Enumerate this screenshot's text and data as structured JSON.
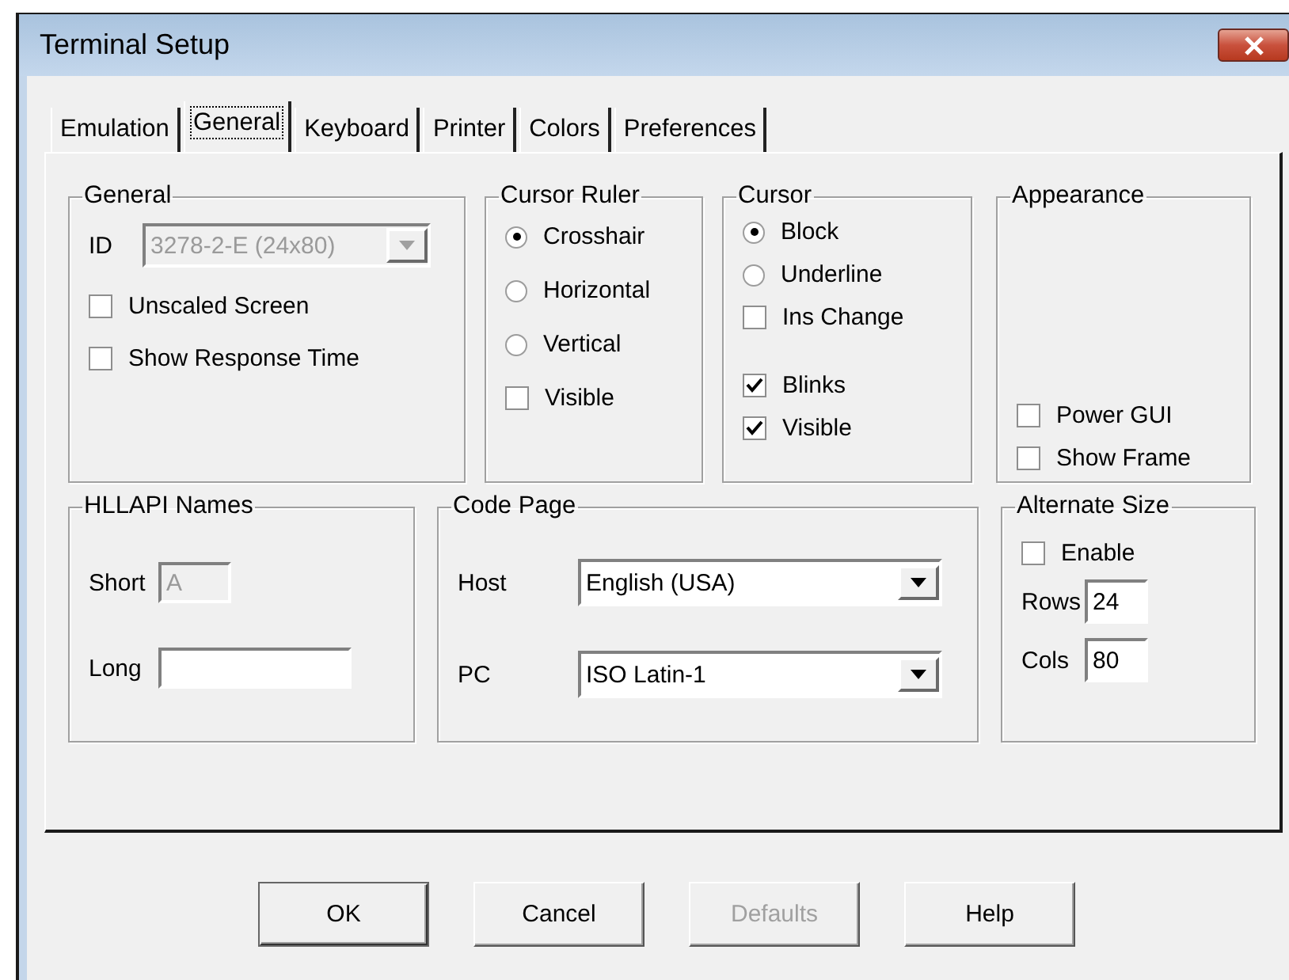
{
  "window": {
    "title": "Terminal Setup"
  },
  "tabs": [
    {
      "label": "Emulation",
      "selected": false
    },
    {
      "label": "General",
      "selected": true
    },
    {
      "label": "Keyboard",
      "selected": false
    },
    {
      "label": "Printer",
      "selected": false
    },
    {
      "label": "Colors",
      "selected": false
    },
    {
      "label": "Preferences",
      "selected": false
    }
  ],
  "rows": [
    [
      {
        "title": "General",
        "items": [
          {
            "kind": "dropdown",
            "label": "ID",
            "value": "3278-2-E (24x80)",
            "disabled": true
          },
          {
            "kind": "checkbox",
            "label": "Unscaled Screen",
            "checked": false
          },
          {
            "kind": "checkbox",
            "label": "Show Response Time",
            "checked": false
          }
        ]
      },
      {
        "title": "Cursor Ruler",
        "items": [
          {
            "kind": "radio",
            "label": "Crosshair",
            "selected": true
          },
          {
            "kind": "radio",
            "label": "Horizontal",
            "selected": false
          },
          {
            "kind": "radio",
            "label": "Vertical",
            "selected": false
          },
          {
            "kind": "checkbox",
            "label": "Visible",
            "checked": false
          }
        ]
      },
      {
        "title": "Cursor",
        "items": [
          {
            "kind": "radio",
            "label": "Block",
            "selected": true
          },
          {
            "kind": "radio",
            "label": "Underline",
            "selected": false
          },
          {
            "kind": "checkbox",
            "label": "Ins Change",
            "checked": false
          },
          {
            "kind": "checkbox",
            "label": "Blinks",
            "checked": true
          },
          {
            "kind": "checkbox",
            "label": "Visible",
            "checked": true
          }
        ]
      },
      {
        "title": "Appearance",
        "items": [
          {
            "kind": "checkbox",
            "label": "Power GUI",
            "checked": false
          },
          {
            "kind": "checkbox",
            "label": "Show Frame",
            "checked": false
          }
        ]
      }
    ],
    [
      {
        "title": "HLLAPI Names",
        "items": [
          {
            "kind": "text-field",
            "label": "Short",
            "value": "A",
            "disabled": true
          },
          {
            "kind": "text-field",
            "label": "Long",
            "disabled": false
          }
        ]
      },
      {
        "title": "Code Page",
        "items": [
          {
            "kind": "dropdown",
            "label": "Host",
            "value": "English (USA)",
            "disabled": false
          },
          {
            "kind": "dropdown",
            "label": "PC",
            "value": "ISO Latin-1",
            "disabled": false
          }
        ]
      },
      {
        "title": "Alternate Size",
        "items": [
          {
            "kind": "checkbox",
            "label": "Enable",
            "checked": false
          },
          {
            "kind": "text-field",
            "label": "Rows",
            "value": "24",
            "disabled": false
          },
          {
            "kind": "text-field",
            "label": "Cols",
            "value": "80",
            "disabled": false
          }
        ]
      }
    ]
  ],
  "buttons": [
    {
      "label": "OK",
      "default": true,
      "disabled": false
    },
    {
      "label": "Cancel",
      "default": false,
      "disabled": false
    },
    {
      "label": "Defaults",
      "default": false,
      "disabled": true
    },
    {
      "label": "Help",
      "default": false,
      "disabled": false
    }
  ]
}
